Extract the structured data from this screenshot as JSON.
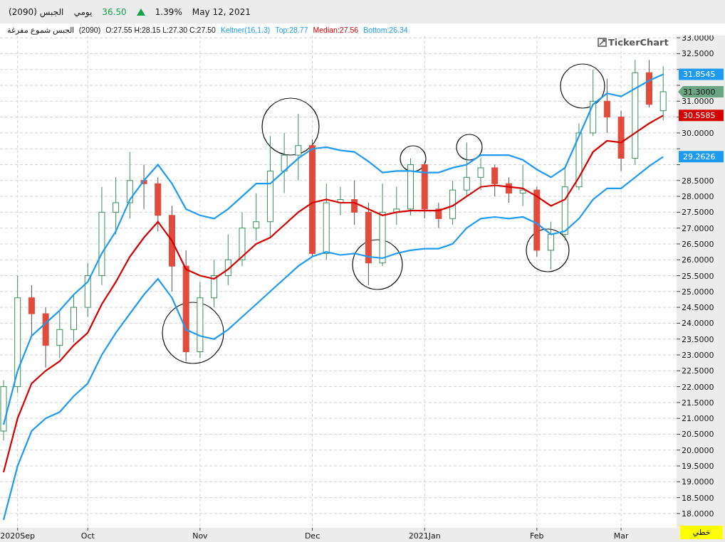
{
  "header": {
    "symbol": "الجبس (2090)",
    "period": "يومي",
    "price": "36.50",
    "rising": true,
    "change": "1.39%",
    "date": "May 12, 2021"
  },
  "legend": {
    "title": "الجبس شموع مفرغة",
    "code": "(2090)",
    "ohlc": "O:27.55 H:28.15 L:27.30 C:27.50",
    "indicator": "Keltner(16,1.3)",
    "top": ":28.77",
    "median": ":27.56",
    "bottom": ":26.34"
  },
  "brand": "TickerChart",
  "chart_type_button": "خطي",
  "chart": {
    "chart_data": {
      "type": "candlestick",
      "ylim": [
        17.55,
        33.07
      ],
      "grid": true,
      "categories": [
        null,
        "2020Sep",
        null,
        null,
        null,
        null,
        "Oct",
        null,
        null,
        null,
        null,
        null,
        null,
        null,
        "Nov",
        null,
        null,
        null,
        null,
        null,
        null,
        null,
        "Dec",
        null,
        null,
        null,
        null,
        null,
        null,
        null,
        "2021Jan",
        null,
        null,
        null,
        null,
        null,
        null,
        null,
        "Feb",
        null,
        null,
        null,
        null,
        null,
        "Mar",
        null,
        null,
        null
      ],
      "yticks": [
        {
          "value": 18,
          "label": "18.0000"
        },
        {
          "value": 18.5,
          "label": "18.5000"
        },
        {
          "value": 19,
          "label": "19.0000"
        },
        {
          "value": 19.5,
          "label": "19.5000"
        },
        {
          "value": 20,
          "label": "20.0000"
        },
        {
          "value": 20.5,
          "label": "20.5000"
        },
        {
          "value": 21,
          "label": "21.0000"
        },
        {
          "value": 21.5,
          "label": "21.5000"
        },
        {
          "value": 22,
          "label": "22.0000"
        },
        {
          "value": 22.5,
          "label": "22.5000"
        },
        {
          "value": 23,
          "label": "23.0000"
        },
        {
          "value": 23.5,
          "label": "23.5000"
        },
        {
          "value": 24,
          "label": "24.0000"
        },
        {
          "value": 24.5,
          "label": "24.5000"
        },
        {
          "value": 25,
          "label": "25.0000"
        },
        {
          "value": 25.5,
          "label": "25.5000"
        },
        {
          "value": 26,
          "label": "26.0000"
        },
        {
          "value": 26.5,
          "label": "26.5000"
        },
        {
          "value": 27,
          "label": "27.0000"
        },
        {
          "value": 27.5,
          "label": "27.5000"
        },
        {
          "value": 28,
          "label": "28.0000"
        },
        {
          "value": 28.5,
          "label": "28.5000"
        },
        {
          "value": 30,
          "label": "30.0000"
        },
        {
          "value": 31,
          "label": "31.0000"
        },
        {
          "value": 32.5,
          "label": "32.5000"
        },
        {
          "value": 33,
          "label": "33.0000"
        }
      ],
      "ohlc": [
        [
          20.6,
          22.2,
          20.3,
          22.0
        ],
        [
          22.0,
          25.5,
          21.8,
          24.8
        ],
        [
          24.8,
          25.2,
          23.6,
          24.3
        ],
        [
          24.3,
          24.5,
          22.6,
          23.3
        ],
        [
          23.3,
          24.4,
          22.9,
          23.8
        ],
        [
          23.8,
          24.9,
          23.4,
          24.5
        ],
        [
          24.5,
          25.9,
          24.2,
          25.5
        ],
        [
          25.5,
          28.3,
          25.2,
          27.5
        ],
        [
          27.5,
          28.6,
          26.8,
          27.8
        ],
        [
          27.8,
          29.4,
          27.3,
          28.5
        ],
        [
          28.5,
          29.0,
          27.6,
          28.4
        ],
        [
          28.4,
          28.6,
          26.9,
          27.4
        ],
        [
          27.4,
          27.7,
          25.0,
          25.8
        ],
        [
          25.8,
          26.3,
          22.8,
          23.1
        ],
        [
          23.1,
          25.3,
          22.9,
          24.8
        ],
        [
          24.8,
          26.0,
          24.5,
          25.5
        ],
        [
          25.5,
          26.8,
          25.2,
          26.0
        ],
        [
          26.0,
          27.5,
          25.8,
          27.0
        ],
        [
          27.0,
          28.1,
          26.6,
          27.2
        ],
        [
          27.2,
          29.9,
          26.7,
          28.8
        ],
        [
          28.8,
          30.0,
          28.1,
          29.3
        ],
        [
          29.3,
          30.6,
          28.5,
          29.6
        ],
        [
          29.6,
          29.8,
          26.1,
          26.2
        ],
        [
          26.2,
          28.4,
          26.0,
          27.8
        ],
        [
          27.8,
          28.3,
          27.4,
          27.9
        ],
        [
          27.9,
          28.5,
          27.1,
          27.5
        ],
        [
          27.5,
          27.8,
          25.2,
          25.9
        ],
        [
          25.9,
          28.4,
          25.8,
          27.5
        ],
        [
          27.5,
          28.3,
          27.1,
          27.6
        ],
        [
          27.6,
          29.2,
          27.4,
          29.0
        ],
        [
          29.0,
          29.1,
          27.3,
          27.6
        ],
        [
          27.6,
          27.8,
          27.0,
          27.3
        ],
        [
          27.3,
          28.5,
          27.1,
          28.2
        ],
        [
          28.2,
          29.7,
          28.0,
          28.6
        ],
        [
          28.6,
          29.2,
          28.2,
          28.9
        ],
        [
          28.9,
          29.0,
          28.0,
          28.4
        ],
        [
          28.4,
          28.6,
          27.8,
          28.1
        ],
        [
          28.1,
          29.0,
          27.7,
          28.2
        ],
        [
          28.2,
          28.3,
          26.1,
          26.3
        ],
        [
          26.3,
          27.2,
          25.7,
          26.8
        ],
        [
          26.8,
          28.9,
          26.6,
          28.3
        ],
        [
          28.3,
          30.3,
          28.2,
          30.0
        ],
        [
          30.0,
          32.0,
          29.9,
          31.0
        ],
        [
          31.0,
          31.7,
          30.0,
          30.5
        ],
        [
          30.5,
          30.7,
          28.8,
          29.2
        ],
        [
          29.2,
          32.3,
          29.0,
          31.9
        ],
        [
          31.9,
          32.3,
          30.8,
          30.9
        ],
        [
          30.7,
          32.1,
          30.4,
          31.3
        ]
      ],
      "series": [
        {
          "name": "Top",
          "type": "line",
          "color": "#1e9bf0",
          "values": [
            20.8,
            22.5,
            23.6,
            24.0,
            24.4,
            24.9,
            25.3,
            26.2,
            26.9,
            27.9,
            28.5,
            29.0,
            28.4,
            27.6,
            27.4,
            27.3,
            27.6,
            28.0,
            28.4,
            28.4,
            28.8,
            29.2,
            29.5,
            29.55,
            29.45,
            29.4,
            29.1,
            28.75,
            28.8,
            28.8,
            28.75,
            28.75,
            28.9,
            29.0,
            29.3,
            29.3,
            29.3,
            29.15,
            28.85,
            28.6,
            28.9,
            29.9,
            30.9,
            31.25,
            31.15,
            31.4,
            31.65,
            31.85
          ]
        },
        {
          "name": "Median",
          "type": "line",
          "color": "#d40000",
          "values": [
            19.3,
            21.0,
            22.1,
            22.5,
            22.8,
            23.3,
            23.7,
            24.6,
            25.3,
            26.1,
            26.7,
            27.2,
            26.6,
            25.7,
            25.5,
            25.4,
            25.7,
            26.1,
            26.5,
            26.7,
            27.1,
            27.5,
            27.8,
            27.9,
            27.8,
            27.8,
            27.6,
            27.4,
            27.5,
            27.55,
            27.55,
            27.55,
            27.7,
            28.0,
            28.3,
            28.35,
            28.3,
            28.25,
            28.0,
            27.7,
            27.9,
            28.6,
            29.4,
            29.75,
            29.7,
            30.0,
            30.3,
            30.55
          ]
        },
        {
          "name": "Bottom",
          "type": "line",
          "color": "#1e9bf0",
          "values": [
            17.8,
            19.5,
            20.6,
            21.0,
            21.2,
            21.7,
            22.1,
            23.0,
            23.7,
            24.3,
            24.9,
            25.4,
            24.8,
            23.8,
            23.6,
            23.5,
            23.8,
            24.2,
            24.6,
            25.0,
            25.4,
            25.8,
            26.1,
            26.25,
            26.15,
            26.2,
            26.1,
            26.05,
            26.2,
            26.3,
            26.35,
            26.35,
            26.5,
            27.0,
            27.3,
            27.35,
            27.3,
            27.35,
            27.15,
            26.8,
            26.9,
            27.3,
            27.9,
            28.25,
            28.25,
            28.6,
            28.95,
            29.25
          ]
        }
      ]
    },
    "price_tags": [
      {
        "kind": "top",
        "label": "31.8545",
        "color": "#1e9bf0"
      },
      {
        "kind": "close",
        "label": "31.3000",
        "color": "#6aa584"
      },
      {
        "kind": "median",
        "label": "30.5585",
        "color": "#d40000"
      },
      {
        "kind": "bottom",
        "label": "29.2626",
        "color": "#1e9bf0"
      }
    ]
  }
}
